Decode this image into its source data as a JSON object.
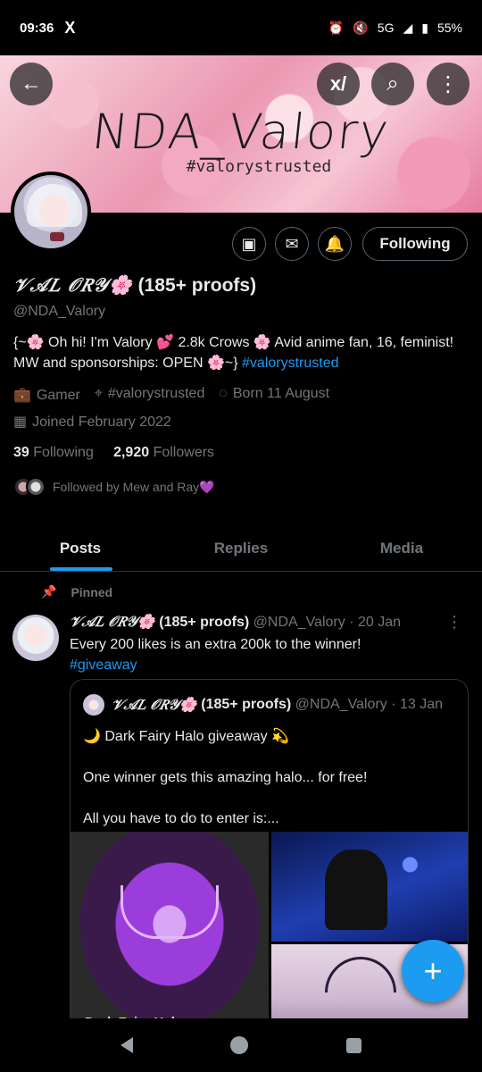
{
  "status": {
    "time": "09:36",
    "app_icon": "X",
    "network": "5G",
    "battery": "55%"
  },
  "banner": {
    "title": "NDA_Valory",
    "subtitle": "#valorystrusted"
  },
  "profile": {
    "display_name_script": "𝒱𝒜𝐿 𝒪𝑅𝒴🌸",
    "display_name_suffix": "(185+ proofs)",
    "handle": "@NDA_Valory",
    "bio_text": "{~🌸 Oh hi! I'm Valory 💕 2.8k Crows 🌸 Avid anime fan, 16, feminist! MW and sponsorships: OPEN 🌸~} ",
    "bio_link": "#valorystrusted",
    "category": "Gamer",
    "location": "#valorystrusted",
    "birthday": "Born 11 August",
    "joined": "Joined February 2022",
    "following_count": "39",
    "following_label": "Following",
    "followers_count": "2,920",
    "followers_label": "Followers",
    "followed_by": "Followed by Mew and Ray💜",
    "follow_button": "Following"
  },
  "tabs": [
    "Posts",
    "Replies",
    "Media"
  ],
  "post": {
    "pinned_label": "Pinned",
    "name_script": "𝒱𝒜𝐿 𝒪𝑅𝒴🌸",
    "name_suffix": "(185+ proofs)",
    "handle_date": "@NDA_Valory · 20 Jan",
    "text": "Every 200 likes is an extra 200k to the winner!",
    "hashtag": "#giveaway"
  },
  "quote": {
    "name_script": "𝒱𝒜𝐿 𝒪𝑅𝒴🌸",
    "name_suffix": "(185+ proofs)",
    "handle_date": "@NDA_Valory · 13 Jan",
    "line1": "🌙 Dark Fairy Halo giveaway 💫",
    "line2": "One winner gets this amazing halo... for free!",
    "line3": "All you have to do to enter is:...",
    "media_caption": "Dark Fairy Hal"
  },
  "fab_symbol": "+",
  "colors": {
    "accent": "#1d9bf0",
    "background": "#000000",
    "muted": "#71767b"
  }
}
